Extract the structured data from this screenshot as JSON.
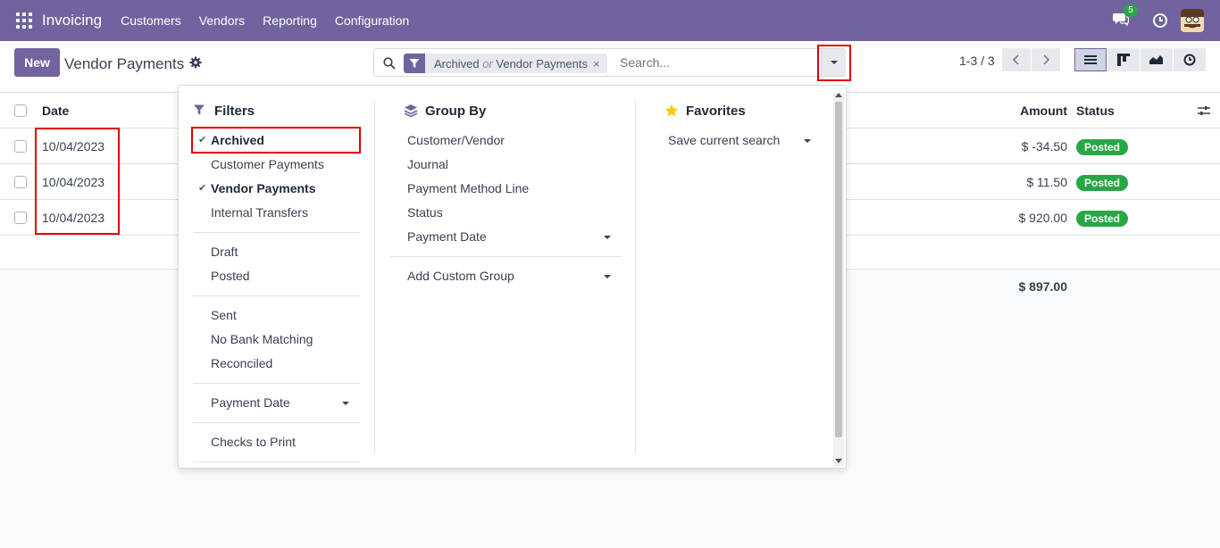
{
  "navbar": {
    "app_name": "Invoicing",
    "menu": [
      "Customers",
      "Vendors",
      "Reporting",
      "Configuration"
    ],
    "chat_badge": "5"
  },
  "control": {
    "new_label": "New",
    "title": "Vendor Payments",
    "search": {
      "facet_value_1": "Archived",
      "facet_or": "or",
      "facet_value_2": "Vendor Payments",
      "facet_remove": "×",
      "placeholder": "Search..."
    },
    "pager": "1-3 / 3"
  },
  "list": {
    "headers": {
      "date": "Date",
      "amount": "Amount",
      "status": "Status"
    },
    "rows": [
      {
        "date": "10/04/2023",
        "amount": "$ -34.50",
        "status": "Posted"
      },
      {
        "date": "10/04/2023",
        "amount": "$ 11.50",
        "status": "Posted"
      },
      {
        "date": "10/04/2023",
        "amount": "$ 920.00",
        "status": "Posted"
      }
    ],
    "total": "$ 897.00"
  },
  "dropdown": {
    "filters": {
      "title": "Filters",
      "items": [
        {
          "label": "Archived",
          "checked": true
        },
        {
          "label": "Customer Payments",
          "checked": false
        },
        {
          "label": "Vendor Payments",
          "checked": true
        },
        {
          "label": "Internal Transfers",
          "checked": false
        },
        {
          "label": "Draft",
          "checked": false
        },
        {
          "label": "Posted",
          "checked": false
        },
        {
          "label": "Sent",
          "checked": false
        },
        {
          "label": "No Bank Matching",
          "checked": false
        },
        {
          "label": "Reconciled",
          "checked": false
        },
        {
          "label": "Payment Date",
          "checked": false
        },
        {
          "label": "Checks to Print",
          "checked": false
        }
      ]
    },
    "group_by": {
      "title": "Group By",
      "items": [
        "Customer/Vendor",
        "Journal",
        "Payment Method Line",
        "Status",
        "Payment Date",
        "Add Custom Group"
      ]
    },
    "favorites": {
      "title": "Favorites",
      "items": [
        "Save current search"
      ]
    }
  },
  "colors": {
    "brand": "#71639e",
    "success": "#28a745",
    "highlight": "#e00000"
  }
}
